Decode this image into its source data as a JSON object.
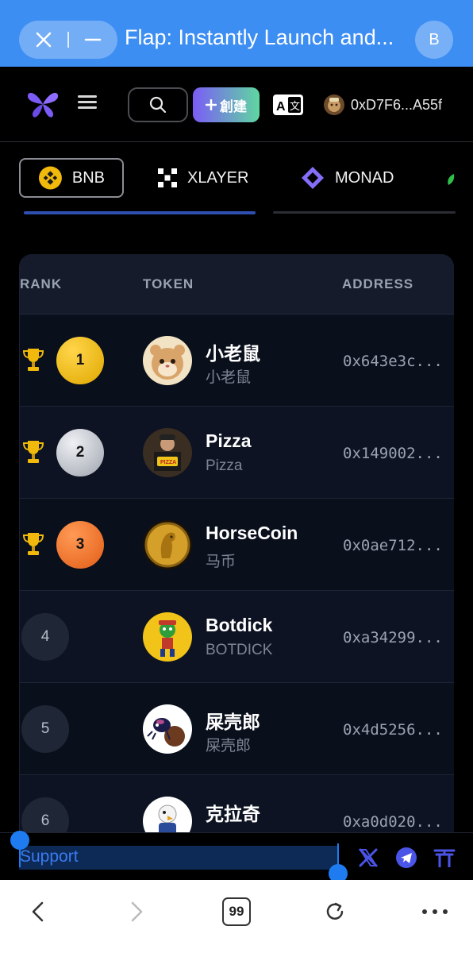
{
  "browser": {
    "tab_title": "Flap: Instantly Launch and...",
    "profile_initial": "B",
    "tab_count": "99"
  },
  "header": {
    "create_label": "創建",
    "wallet_address": "0xD7F6...A55f"
  },
  "chains": [
    {
      "label": "BNB",
      "icon": "bnb-icon",
      "active": true
    },
    {
      "label": "XLAYER",
      "icon": "xlayer-icon",
      "active": false
    },
    {
      "label": "MONAD",
      "icon": "monad-icon",
      "active": false
    }
  ],
  "table": {
    "columns": [
      "RANK",
      "TOKEN",
      "ADDRESS"
    ],
    "rows": [
      {
        "rank": "1",
        "name": "小老鼠",
        "symbol": "小老鼠",
        "address": "0x643e3c...",
        "medal": "gold"
      },
      {
        "rank": "2",
        "name": "Pizza",
        "symbol": "Pizza",
        "address": "0x149002...",
        "medal": "silver"
      },
      {
        "rank": "3",
        "name": "HorseCoin",
        "symbol": "马币",
        "address": "0x0ae712...",
        "medal": "bronze"
      },
      {
        "rank": "4",
        "name": "Botdick",
        "symbol": "BOTDICK",
        "address": "0xa34299...",
        "medal": ""
      },
      {
        "rank": "5",
        "name": "屎壳郎",
        "symbol": "屎壳郎",
        "address": "0x4d5256...",
        "medal": ""
      },
      {
        "rank": "6",
        "name": "克拉奇",
        "symbol": "",
        "address": "0xa0d020...",
        "medal": ""
      }
    ]
  },
  "support": {
    "label": "Support"
  },
  "colors": {
    "browser_accent": "#3d8ef3",
    "gold": "#f0b90b",
    "silver": "#c9ccd3",
    "bronze": "#f47a2a",
    "brand_purple": "#7b5cf6",
    "selection_blue": "#1e7cf0"
  }
}
